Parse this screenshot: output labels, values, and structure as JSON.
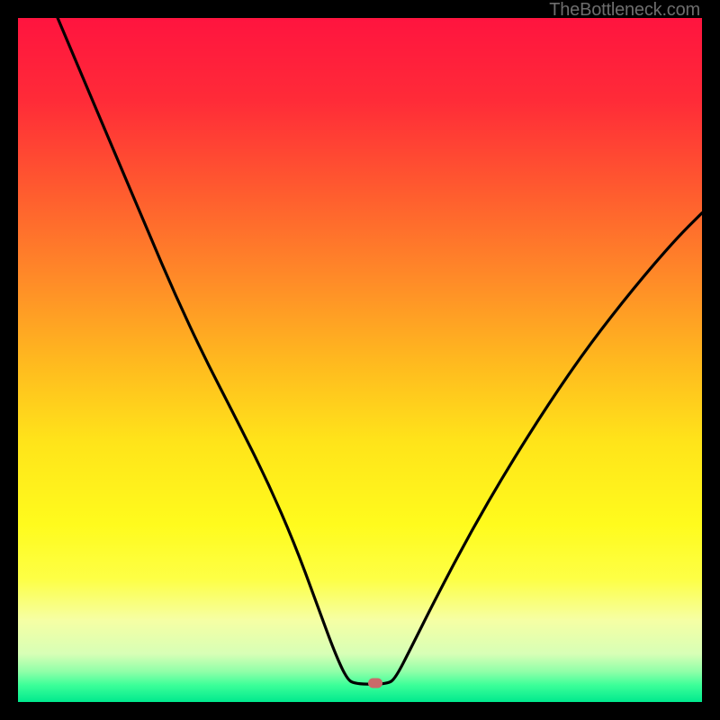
{
  "watermark": {
    "text": "TheBottleneck.com"
  },
  "gradient": {
    "stops": [
      {
        "offset": 0.0,
        "color": "#ff143f"
      },
      {
        "offset": 0.12,
        "color": "#ff2b38"
      },
      {
        "offset": 0.25,
        "color": "#ff5a2f"
      },
      {
        "offset": 0.38,
        "color": "#ff8a28"
      },
      {
        "offset": 0.5,
        "color": "#ffb81f"
      },
      {
        "offset": 0.62,
        "color": "#ffe41a"
      },
      {
        "offset": 0.74,
        "color": "#fffb1d"
      },
      {
        "offset": 0.82,
        "color": "#fdff45"
      },
      {
        "offset": 0.88,
        "color": "#f6ffa4"
      },
      {
        "offset": 0.93,
        "color": "#d7ffb6"
      },
      {
        "offset": 0.956,
        "color": "#8effa8"
      },
      {
        "offset": 0.975,
        "color": "#3dff99"
      },
      {
        "offset": 1.0,
        "color": "#00e98e"
      }
    ]
  },
  "marker": {
    "x_frac": 0.522,
    "y_frac": 0.972,
    "color": "#c96a6a"
  },
  "chart_data": {
    "type": "line",
    "title": "",
    "xlabel": "",
    "ylabel": "",
    "x_range": [
      0,
      1
    ],
    "y_range": [
      0,
      1
    ],
    "notes": "No axis ticks or numeric labels are shown. x_frac and y_frac are fractions of the plot area (0=left/top, 1=right/bottom). Curve descends from top-left, reaches a minimum plateau near x≈0.49–0.54 at the bottom, then rises toward the upper-right.",
    "series": [
      {
        "name": "bottleneck-curve",
        "points": [
          {
            "x_frac": 0.058,
            "y_frac": 0.0
          },
          {
            "x_frac": 0.1,
            "y_frac": 0.1
          },
          {
            "x_frac": 0.145,
            "y_frac": 0.205
          },
          {
            "x_frac": 0.19,
            "y_frac": 0.312
          },
          {
            "x_frac": 0.23,
            "y_frac": 0.405
          },
          {
            "x_frac": 0.272,
            "y_frac": 0.495
          },
          {
            "x_frac": 0.32,
            "y_frac": 0.588
          },
          {
            "x_frac": 0.365,
            "y_frac": 0.678
          },
          {
            "x_frac": 0.405,
            "y_frac": 0.77
          },
          {
            "x_frac": 0.44,
            "y_frac": 0.865
          },
          {
            "x_frac": 0.462,
            "y_frac": 0.925
          },
          {
            "x_frac": 0.48,
            "y_frac": 0.965
          },
          {
            "x_frac": 0.492,
            "y_frac": 0.974
          },
          {
            "x_frac": 0.54,
            "y_frac": 0.974
          },
          {
            "x_frac": 0.552,
            "y_frac": 0.965
          },
          {
            "x_frac": 0.575,
            "y_frac": 0.92
          },
          {
            "x_frac": 0.61,
            "y_frac": 0.85
          },
          {
            "x_frac": 0.66,
            "y_frac": 0.755
          },
          {
            "x_frac": 0.715,
            "y_frac": 0.66
          },
          {
            "x_frac": 0.775,
            "y_frac": 0.565
          },
          {
            "x_frac": 0.835,
            "y_frac": 0.478
          },
          {
            "x_frac": 0.9,
            "y_frac": 0.395
          },
          {
            "x_frac": 0.96,
            "y_frac": 0.325
          },
          {
            "x_frac": 1.0,
            "y_frac": 0.285
          }
        ]
      }
    ],
    "marker_point": {
      "x_frac": 0.522,
      "y_frac": 0.972
    }
  }
}
